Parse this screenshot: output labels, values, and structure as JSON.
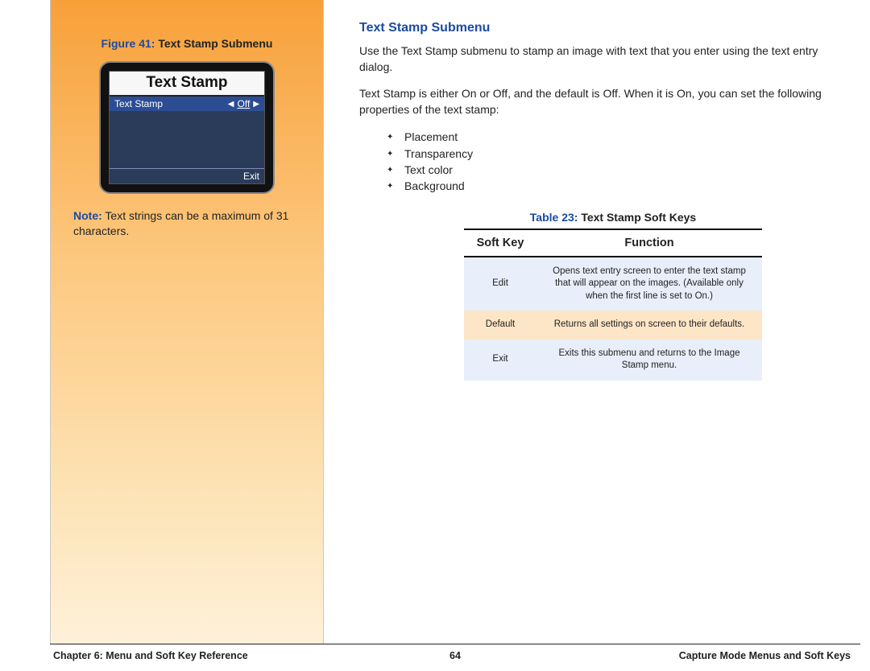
{
  "sidebar": {
    "figure_label": "Figure 41:",
    "figure_title": " Text Stamp Submenu",
    "lcd": {
      "title": "Text Stamp",
      "row_label": "Text Stamp",
      "row_value": "Off",
      "footer": "Exit"
    },
    "note_label": "Note:",
    "note_text": " Text strings can be a maximum of 31 characters."
  },
  "main": {
    "heading": "Text Stamp Submenu",
    "para1": "Use the Text Stamp submenu to stamp an image with text that you enter using the text entry dialog.",
    "para2": "Text Stamp is either On or Off, and the default is Off. When it is On, you can set the following properties of the text stamp:",
    "bullets": [
      "Placement",
      "Transparency",
      "Text color",
      "Background"
    ],
    "table_label": "Table 23:",
    "table_title": " Text Stamp Soft Keys",
    "table_headers": [
      "Soft Key",
      "Function"
    ],
    "table_rows": [
      {
        "key": "Edit",
        "fn": "Opens text entry screen to enter the text stamp that will appear on the images. (Available only when the first line is set to On.)"
      },
      {
        "key": "Default",
        "fn": "Returns all settings on screen to their defaults."
      },
      {
        "key": "Exit",
        "fn": "Exits this submenu and returns to the Image Stamp menu."
      }
    ]
  },
  "footer": {
    "left": "Chapter 6: Menu and Soft Key Reference",
    "center": "64",
    "right": "Capture Mode Menus and Soft Keys"
  }
}
